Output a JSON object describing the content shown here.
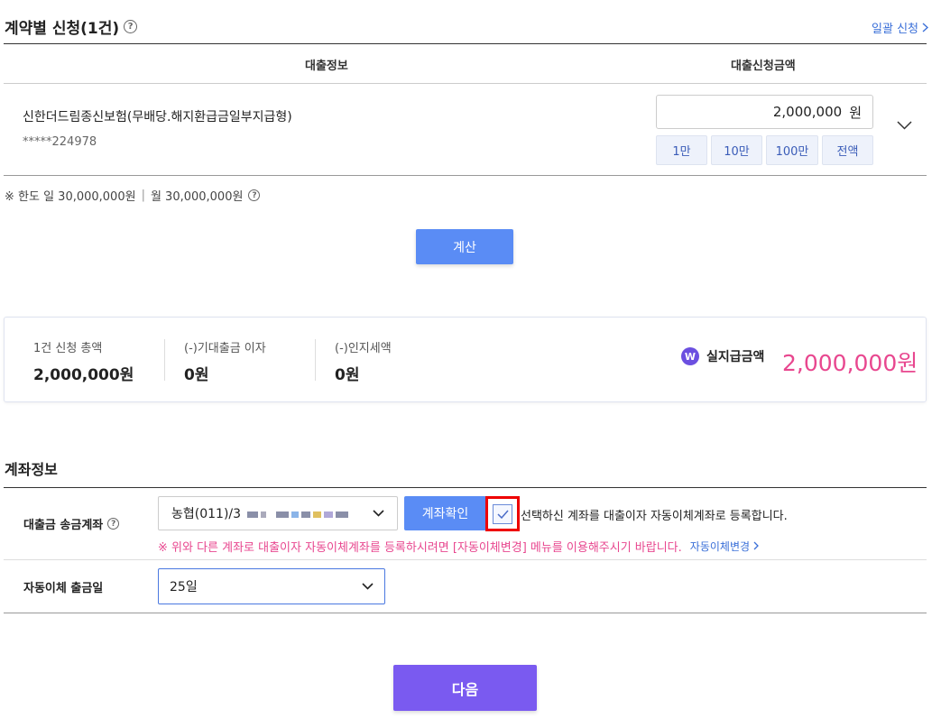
{
  "section1": {
    "title": "계약별 신청(1건)",
    "bulk_link": "일괄 신청",
    "col_loan_info": "대출정보",
    "col_amount": "대출신청금액",
    "product_name": "신한더드림종신보험(무배당.해지환급금일부지급형)",
    "product_no": "*****224978",
    "amount_value": "2,000,000",
    "amount_unit": "원",
    "quick_buttons": [
      "1만",
      "10만",
      "100만",
      "전액"
    ],
    "limit_daily": "※ 한도 일 30,000,000원",
    "limit_sep": "|",
    "limit_monthly": "월 30,000,000원",
    "calc_label": "계산"
  },
  "summary": {
    "total_label": "1건 신청 총액",
    "total_value": "2,000,000원",
    "interest_label": "(-)기대출금 이자",
    "interest_value": "0원",
    "stamp_label": "(-)인지세액",
    "stamp_value": "0원",
    "net_label": "실지급금액",
    "net_value": "2,000,000원"
  },
  "account": {
    "title": "계좌정보",
    "transfer_label": "대출금 송금계좌",
    "account_value": "농협(011)/3",
    "verify_label": "계좌확인",
    "checkbox_text": "선택하신 계좌를 대출이자 자동이체계좌로 등록합니다.",
    "warning": "※ 위와 다른 계좌로 대출이자 자동이체계좌를 등록하시려면 [자동이체변경] 메뉴를 이용해주시기 바랍니다.",
    "warning_link": "자동이체변경",
    "autodebit_label": "자동이체 출금일",
    "autodebit_value": "25일"
  },
  "next_label": "다음"
}
